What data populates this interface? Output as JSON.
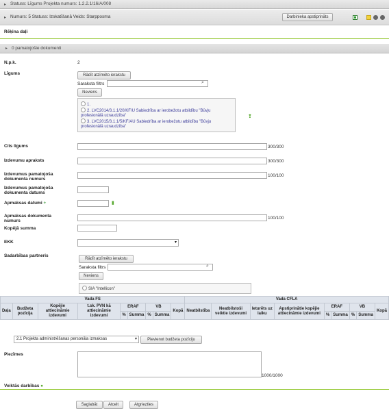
{
  "header": {
    "status_line": "Statuss: Līgums   Projekta numurs: 1.2.2.1/16/A/008",
    "detail_line": "Numurs: 5   Statuss: Izskatīšanā   Veids: Starpposma",
    "approve_button": "Darbinieka apstiprināts"
  },
  "section": {
    "title": "Rēķina daļi",
    "docs_bar": "0 pamatojošie dokumenti"
  },
  "form": {
    "npk_label": "N.p.k.",
    "npk_value": "2",
    "ligums_label": "Līgums",
    "show_selected_button": "Rādīt atzīmēto ierakstu",
    "filter_label": "Saraksta filtrs",
    "none_button": "Neviens",
    "ligums_options": [
      "1.",
      "2. LVC2014/3.1.1/20/KF/U Sabiedrība ar ierobežotu atbildību \"Būvju",
      "profesionālā uzraudzība\"",
      "3. LVC2015/3.1.1/5/KF/AU Sabiedrība ar ierobežotu atbildību \"Būvju",
      "profesionālā uzraudzība\""
    ],
    "cits_label": "Cits līgums",
    "cits_count": "300/300",
    "apraksts_label": "Izdevumu apraksts",
    "apraksts_count": "300/300",
    "pam_num_label_1": "Izdevumus pamatojoša",
    "pam_num_label_2": "dokumenta numurs",
    "pam_num_count": "100/100",
    "pam_dat_label_1": "Izdevumus pamatojoša",
    "pam_dat_label_2": "dokumenta datums",
    "apm_dat_label": "Apmaksas datumi",
    "apm_num_label_1": "Apmaksas dokumenta",
    "apm_num_label_2": "numurs",
    "apm_num_count": "100/100",
    "kopeja_label": "Kopējā summa",
    "ekk_label": "EKK",
    "partneris_label": "Sadarbības partneris",
    "partner_option": "SIA \"Intellicon\""
  },
  "table": {
    "group_fs": "Vada FS",
    "group_cfla": "Vada CFLA",
    "headers": {
      "daja": "Daļa",
      "budzeta": "Budžeta pozīcija",
      "kopejie": "Kopējie attiecināmie izdevumi",
      "pvn": "t.sk. PVN kā attiecināmie izdevumi",
      "eraf": "ERAF",
      "vb": "VB",
      "kopa": "Kopā",
      "neatbilstiba": "Neatbilstība",
      "neatbilstosi": "Neatbilstoši veiktie izdevumi",
      "ieturets": "Ieturēts uz laiku",
      "apstiprinatie": "Apstiprinātie kopējie attiecināmie izdevumi",
      "pct": "%",
      "summa": "Summa"
    },
    "budget_select": "2.1 Projekta administrēšanas personāla izmaksas",
    "add_button": "Pievienot budžeta pozīciju"
  },
  "notes": {
    "label": "Piezīmes",
    "count": "1000/1000"
  },
  "actions": {
    "title": "Veiktās darbības",
    "save": "Saglabāt",
    "cancel": "Atcelt",
    "approve": "Atgriezties"
  },
  "colors": {
    "accent_green": "#9acb3c",
    "table_header": "#dfe4ec"
  }
}
